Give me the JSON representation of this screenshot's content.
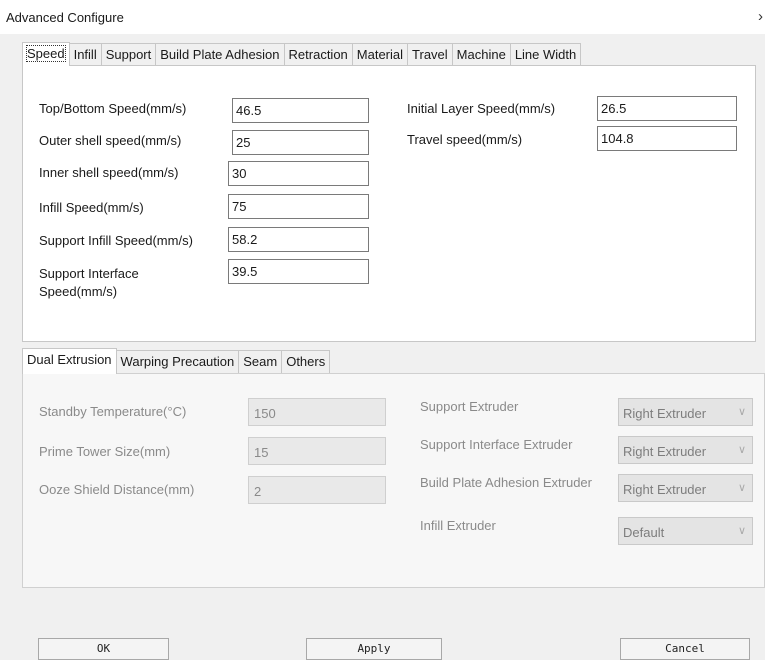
{
  "window": {
    "title": "Advanced Configure",
    "close_glyph": "›"
  },
  "tabs": [
    "Speed",
    "Infill",
    "Support",
    "Build Plate Adhesion",
    "Retraction",
    "Material",
    "Travel",
    "Machine",
    "Line Width"
  ],
  "speed": {
    "top_bottom": {
      "label": "Top/Bottom Speed(mm/s)",
      "value": "46.5"
    },
    "outer_shell": {
      "label": "Outer shell speed(mm/s)",
      "value": "25"
    },
    "inner_shell": {
      "label": "Inner shell speed(mm/s)",
      "value": "30"
    },
    "infill": {
      "label": "Infill Speed(mm/s)",
      "value": "75"
    },
    "support_infill": {
      "label": "Support Infill Speed(mm/s)",
      "value": "58.2"
    },
    "support_interface": {
      "label_line1": "Support Interface",
      "label_line2": "Speed(mm/s)",
      "value": "39.5"
    },
    "initial_layer": {
      "label": "Initial Layer Speed(mm/s)",
      "value": "26.5"
    },
    "travel": {
      "label": "Travel speed(mm/s)",
      "value": "104.8"
    }
  },
  "lower_tabs": [
    "Dual Extrusion",
    "Warping Precaution",
    "Seam",
    "Others"
  ],
  "dual": {
    "standby_temp": {
      "label": "Standby Temperature(°C)",
      "value": "150"
    },
    "prime_tower": {
      "label": "Prime Tower Size(mm)",
      "value": "15"
    },
    "ooze_shield": {
      "label": "Ooze Shield Distance(mm)",
      "value": "2"
    },
    "support_extruder": {
      "label": "Support Extruder",
      "value": "Right Extruder"
    },
    "support_interface_extruder": {
      "label": "Support Interface Extruder",
      "value": "Right Extruder"
    },
    "build_plate_extruder": {
      "label": "Build Plate Adhesion Extruder",
      "value": "Right Extruder"
    },
    "infill_extruder": {
      "label": "Infill Extruder",
      "value": "Default"
    }
  },
  "buttons": {
    "ok": "OK",
    "apply": "Apply",
    "cancel": "Cancel"
  }
}
